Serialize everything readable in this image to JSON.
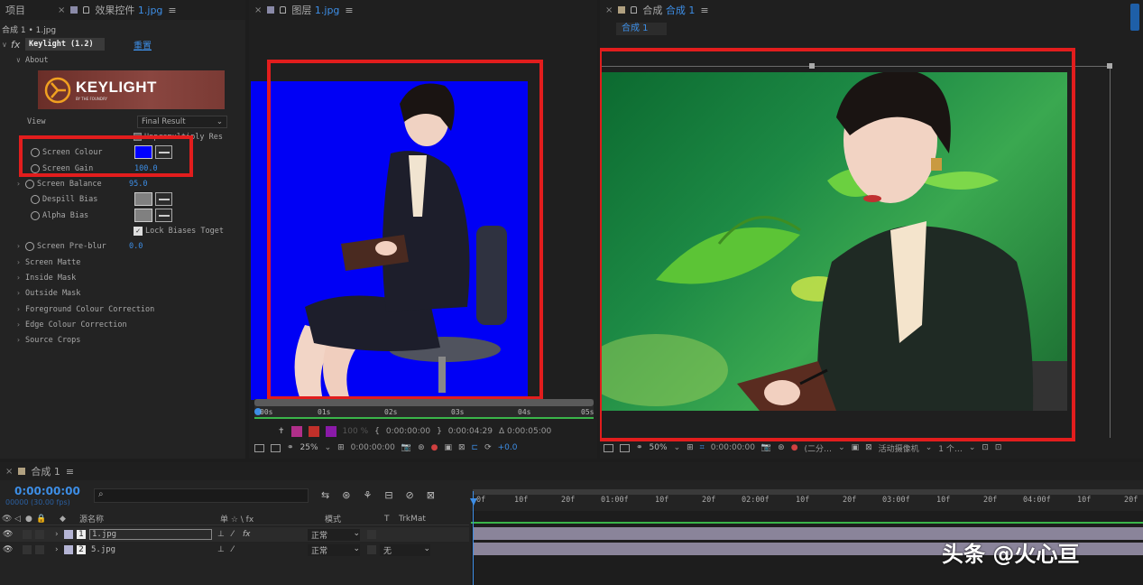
{
  "project_panel": {
    "tab_label": "项目"
  },
  "effect_controls": {
    "tab_label": "效果控件",
    "tab_file": "1.jpg",
    "breadcrumb": "合成 1 • 1.jpg",
    "fx_label": "fx",
    "effect_name": "Keylight (1.2)",
    "reset_label": "重置",
    "about_label": "About",
    "logo_text": "KEYLIGHT",
    "logo_sub": "BY THE FOUNDRY",
    "view_label": "View",
    "view_value": "Final Result",
    "unpremultiply_label": "Unpremultiply Res",
    "screen_colour_label": "Screen Colour",
    "screen_colour": "#0000ff",
    "screen_gain_label": "Screen Gain",
    "screen_gain_value": "100.0",
    "screen_balance_label": "Screen Balance",
    "screen_balance_value": "95.0",
    "despill_bias_label": "Despill Bias",
    "alpha_bias_label": "Alpha Bias",
    "lock_biases_label": "Lock Biases Toget",
    "screen_preblur_label": "Screen Pre-blur",
    "screen_preblur_value": "0.0",
    "groups": [
      "Screen Matte",
      "Inside Mask",
      "Outside Mask",
      "Foreground Colour Correction",
      "Edge Colour Correction",
      "Source Crops"
    ]
  },
  "layer_panel": {
    "tab_label": "图层",
    "tab_file": "1.jpg",
    "ruler_labels": [
      "00s",
      "01s",
      "02s",
      "03s",
      "04s",
      "05s"
    ],
    "opacity": "100 %",
    "in_time": "0:00:00:00",
    "out_time": "0:00:04:29",
    "duration": "Δ 0:00:05:00",
    "zoom": "25%",
    "current_time": "0:00:00:00",
    "exposure": "+0.0"
  },
  "comp_panel": {
    "tab_label": "合成",
    "tab_name": "合成 1",
    "sub_tab": "合成 1",
    "zoom": "50%",
    "current_time": "0:00:00:00",
    "resolution": "(二分…",
    "camera": "活动摄像机",
    "views": "1 个…"
  },
  "timeline": {
    "tab_label": "合成 1",
    "timecode": "0:00:00:00",
    "frame_info": "00000 (30.00 fps)",
    "search_placeholder": "",
    "col_source_name": "源名称",
    "col_switches": "单 ☆ \\ fx",
    "col_mode": "模式",
    "col_t": "T",
    "col_trkmat": "TrkMat",
    "ruler": [
      "0f",
      "10f",
      "20f",
      "01:00f",
      "10f",
      "20f",
      "02:00f",
      "10f",
      "20f",
      "03:00f",
      "10f",
      "20f",
      "04:00f",
      "10f",
      "20f"
    ],
    "layers": [
      {
        "num": "1",
        "name": "1.jpg",
        "mode": "正常",
        "trkmat": "",
        "fx": "fx"
      },
      {
        "num": "2",
        "name": "5.jpg",
        "mode": "正常",
        "trkmat": "无",
        "fx": ""
      }
    ]
  },
  "watermark": "头条 @火心亘"
}
